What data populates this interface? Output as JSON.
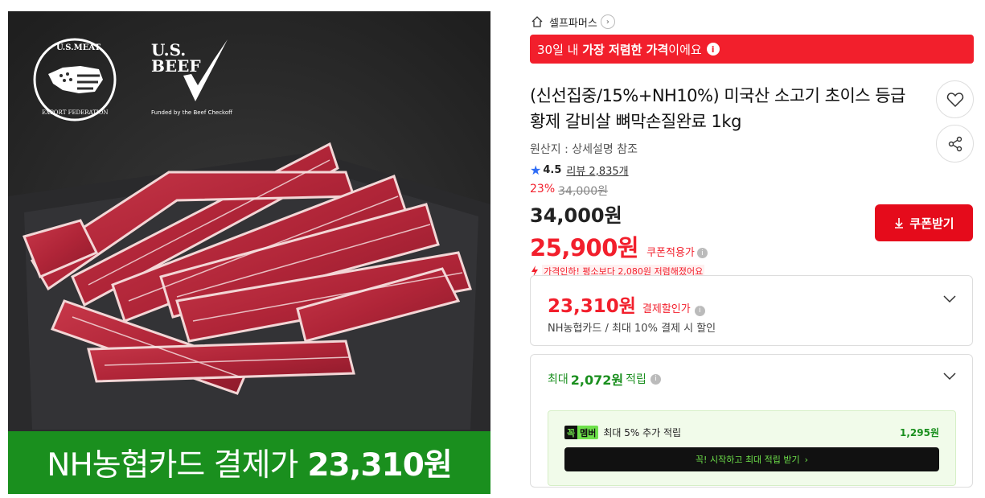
{
  "hero": {
    "logo_usmef_top": "U.S.MEAT",
    "logo_usmef_bottom": "EXPORT FEDERATION",
    "logo_usbeef_line1": "U.S.",
    "logo_usbeef_line2": "BEEF",
    "logo_usbeef_sub": "Funded by the Beef Checkoff",
    "banner_text": "NH농협카드 결제가",
    "banner_price": "23,310원",
    "banner_color": "#1a8f1e"
  },
  "store": {
    "name": "셀프파머스"
  },
  "lowest_banner": {
    "prefix": "30일 내 ",
    "strong": "가장 저렴한 가격",
    "suffix": "이에요",
    "color": "#f21f2c"
  },
  "product": {
    "title": "(신선집중/15%+NH10%) 미국산 소고기 초이스 등급 황제 갈비살 뼈막손질완료 1kg",
    "origin": "원산지 : 상세설명 참조",
    "rating": "4.5",
    "review_label": "리뷰 2,835개",
    "discount_rate": "23%",
    "original_price": "34,000원",
    "price": "34,000원",
    "coupon_price": "25,900원",
    "coupon_price_label": "쿠폰적용가",
    "price_drop_note": "가격인하! 평소보다 2,080원 저렴해졌어요"
  },
  "actions": {
    "coupon_button": "쿠폰받기",
    "accent": "#e50b1b"
  },
  "card_payment": {
    "amount": "23,310원",
    "label": "결제할인가",
    "sub": "NH농협카드 / 최대 10% 결제 시 할인"
  },
  "points": {
    "prefix": "최대",
    "amount": "2,072원",
    "suffix": "적립",
    "member_badge_1": "꼭",
    "member_badge_2": "멤버",
    "member_text": "최대 5% 추가 적립",
    "member_amount": "1,295원",
    "member_button": "꼭! 시작하고 최대 적립 받기",
    "color": "#1a8f1e"
  }
}
